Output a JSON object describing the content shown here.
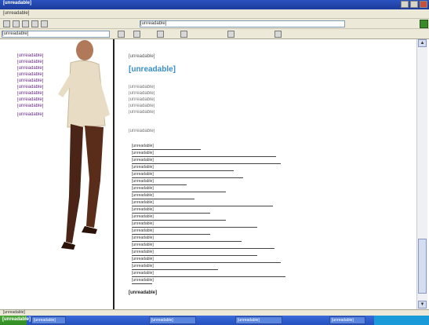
{
  "window": {
    "title": "[unreadable]",
    "menu": [
      "[unreadable]"
    ],
    "address": "[unreadable]",
    "search_placeholder": "[unreadable]",
    "status_text": "[unreadable]"
  },
  "nav": {
    "items": [
      {
        "label": "[unreadable]"
      },
      {
        "label": "[unreadable]"
      },
      {
        "label": "[unreadable]"
      },
      {
        "label": "[unreadable]"
      },
      {
        "label": "[unreadable]"
      },
      {
        "label": "[unreadable]"
      },
      {
        "label": "[unreadable]"
      },
      {
        "label": "[unreadable]"
      },
      {
        "label": "[unreadable]"
      },
      {
        "label": "[unreadable]"
      }
    ],
    "link_color": "#6b2a8c"
  },
  "main": {
    "breadcrumb": "[unreadable]",
    "heading": "[unreadable]",
    "heading_color": "#3a8fc8",
    "paragraphs": [
      "[unreadable]",
      "[unreadable]",
      "[unreadable]",
      "[unreadable]",
      "[unreadable]"
    ],
    "section_label": "[unreadable]",
    "links": [
      "[unreadable]",
      "[unreadable]",
      "[unreadable]",
      "[unreadable]",
      "[unreadable]",
      "[unreadable]",
      "[unreadable]",
      "[unreadable]",
      "[unreadable]",
      "[unreadable]",
      "[unreadable]",
      "[unreadable]",
      "[unreadable]",
      "[unreadable]",
      "[unreadable]",
      "[unreadable]",
      "[unreadable]",
      "[unreadable]",
      "[unreadable]",
      "[unreadable]"
    ],
    "subheading": "[unreadable]"
  },
  "taskbar": {
    "start_label": "[unreadable]",
    "tasks": [
      "[unreadable]",
      "[unreadable]",
      "[unreadable]",
      "[unreadable]"
    ]
  }
}
